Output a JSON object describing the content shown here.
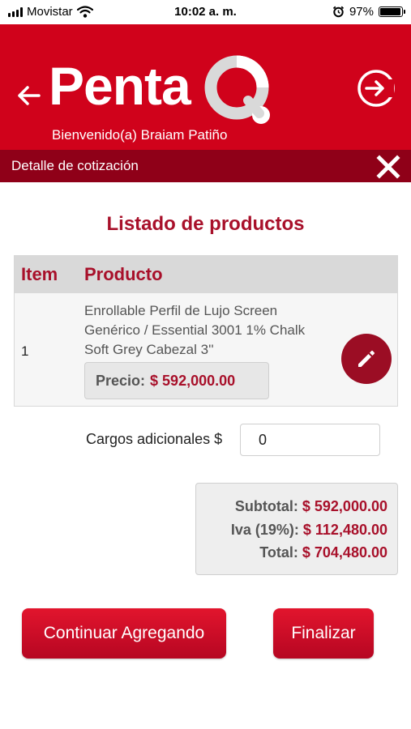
{
  "status_bar": {
    "carrier": "Movistar",
    "time": "10:02 a. m.",
    "battery_percent": "97%",
    "battery_level": 0.97
  },
  "header": {
    "logo_text": "Penta",
    "welcome": "Bienvenido(a) Braiam Patiño",
    "brand_color": "#d0021b"
  },
  "subbar": {
    "title": "Detalle de cotización"
  },
  "products": {
    "title": "Listado de productos",
    "columns": [
      "Item",
      "Producto"
    ],
    "rows": [
      {
        "index": "1",
        "description": "Enrollable Perfil de Lujo Screen Genérico / Essential 3001 1% Chalk Soft Grey Cabezal 3''",
        "price_label": "Precio:",
        "price": "$ 592,000.00"
      }
    ]
  },
  "charges": {
    "label": "Cargos adicionales $",
    "value": "0"
  },
  "totals": {
    "subtotal_label": "Subtotal:",
    "subtotal": "$ 592,000.00",
    "iva_label": "Iva (19%):",
    "iva": "$ 112,480.00",
    "total_label": "Total:",
    "total": "$ 704,480.00"
  },
  "actions": {
    "continue_label": "Continuar Agregando",
    "finish_label": "Finalizar"
  },
  "icons": {
    "back": "arrow-left-icon",
    "logout": "logout-icon",
    "close": "close-icon",
    "edit": "pencil-icon",
    "alarm": "alarm-clock-icon",
    "wifi": "wifi-icon"
  }
}
